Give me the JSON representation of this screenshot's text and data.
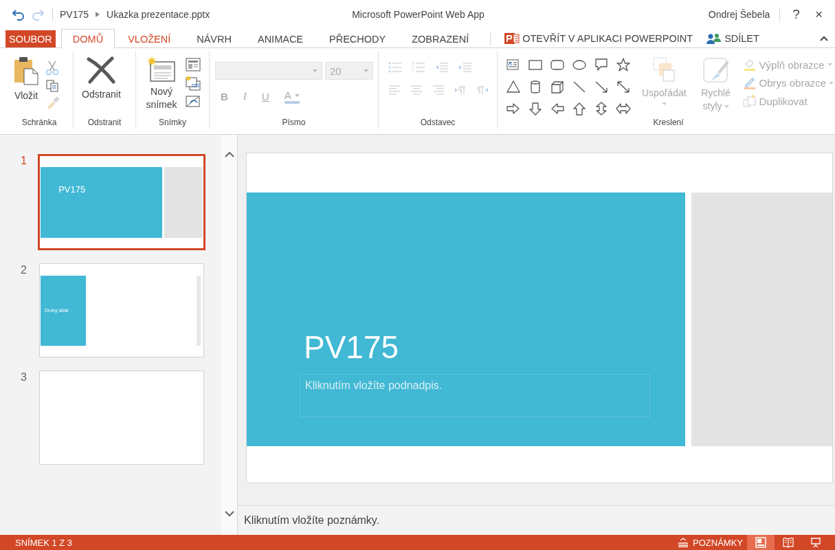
{
  "title_bar": {
    "breadcrumb": [
      "PV175",
      "Ukazka prezentace.pptx"
    ],
    "app_title": "Microsoft PowerPoint Web App",
    "user": "Ondrej Šebela",
    "help": "?",
    "close": "×"
  },
  "tabs": [
    {
      "label": "SOUBOR",
      "kind": "file",
      "selected": false
    },
    {
      "label": "DOMŮ",
      "kind": "tab",
      "selected": true
    },
    {
      "label": "VLOŽENÍ",
      "kind": "accent",
      "selected": false
    },
    {
      "label": "NÁVRH",
      "kind": "tab",
      "selected": false
    },
    {
      "label": "ANIMACE",
      "kind": "tab",
      "selected": false
    },
    {
      "label": "PŘECHODY",
      "kind": "tab",
      "selected": false
    },
    {
      "label": "ZOBRAZENÍ",
      "kind": "tab",
      "selected": false
    }
  ],
  "actions": [
    {
      "label": "OTEVŘÍT V APLIKACI POWERPOINT",
      "kind": "open_app"
    },
    {
      "label": "SDÍLET",
      "kind": "share"
    }
  ],
  "ribbon": [
    {
      "kind": "clipboard",
      "label": "Schránka",
      "disabled": false,
      "buttons": [
        {
          "label": "Vložit"
        }
      ]
    },
    {
      "kind": "delete",
      "label": "Odstranit",
      "disabled": false,
      "buttons": [
        {
          "label": "Odstranit"
        }
      ]
    },
    {
      "kind": "slides",
      "label": "Snímky",
      "disabled": false,
      "buttons": [
        {
          "label": "Nový snímek"
        }
      ]
    },
    {
      "kind": "font",
      "label": "Písmo",
      "disabled": true,
      "font_size": "20",
      "buttons": [
        {
          "label": "B"
        },
        {
          "label": "I"
        },
        {
          "label": "U"
        },
        {
          "label": "A"
        }
      ]
    },
    {
      "kind": "paragraph",
      "label": "Odstavec",
      "disabled": true
    },
    {
      "kind": "drawing",
      "label": "Kreslení",
      "disabled": true,
      "buttons": [
        {
          "label": "Uspořádat"
        },
        {
          "label": "Rychlé styly"
        },
        {
          "label": "Výplň obrazce"
        },
        {
          "label": "Obrys obrazce"
        },
        {
          "label": "Duplikovat"
        }
      ]
    }
  ],
  "slides": [
    {
      "number": "1",
      "selected": true,
      "kind": "title",
      "title": "PV175"
    },
    {
      "number": "2",
      "selected": false,
      "kind": "narrow",
      "title": "Druhý slide"
    },
    {
      "number": "3",
      "selected": false,
      "kind": "blank"
    }
  ],
  "editor": {
    "kind": "title",
    "title": "PV175",
    "subtitle_placeholder": "Kliknutím vložíte podnadpis."
  },
  "notes": {
    "placeholder": "Kliknutím vložíte poznámky."
  },
  "status_bar": {
    "slide_counter": "SNÍMEK 1 Z 3",
    "notes_button": "POZNÁMKY",
    "views": [
      {
        "kind": "normal",
        "selected": true
      },
      {
        "kind": "reading",
        "selected": false
      },
      {
        "kind": "slideshow",
        "selected": false
      }
    ]
  }
}
